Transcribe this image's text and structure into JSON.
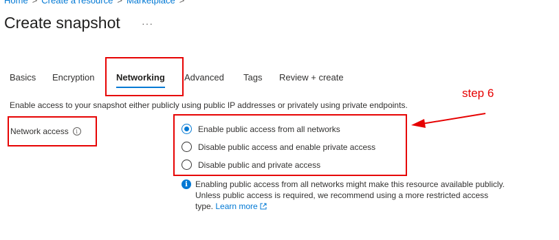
{
  "breadcrumb": {
    "items": [
      "Home",
      "Create a resource",
      "Marketplace"
    ],
    "separator": ">"
  },
  "page": {
    "title": "Create snapshot",
    "more": "···"
  },
  "tabs": [
    {
      "label": "Basics"
    },
    {
      "label": "Encryption"
    },
    {
      "label": "Networking",
      "active": true
    },
    {
      "label": "Advanced"
    },
    {
      "label": "Tags"
    },
    {
      "label": "Review + create"
    }
  ],
  "description": "Enable access to your snapshot either publicly using public IP addresses or privately using private endpoints.",
  "network_access": {
    "label": "Network access",
    "info_icon": "info-icon",
    "options": [
      {
        "label": "Enable public access from all networks",
        "selected": true
      },
      {
        "label": "Disable public access and enable private access",
        "selected": false
      },
      {
        "label": "Disable public and private access",
        "selected": false
      }
    ]
  },
  "info_note": {
    "text": "Enabling public access from all networks might make this resource available publicly. Unless public access is required, we recommend using a more restricted access type.",
    "link": "Learn more"
  },
  "annotation": {
    "step_label": "step 6",
    "color": "#e60000"
  },
  "colors": {
    "accent": "#0078d4",
    "text": "#323130"
  }
}
